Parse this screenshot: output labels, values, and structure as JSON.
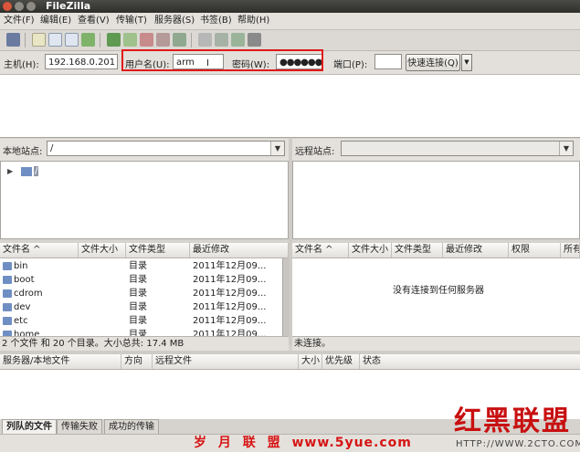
{
  "title": "FileZilla",
  "menu": [
    "文件(F)",
    "编辑(E)",
    "查看(V)",
    "传输(T)",
    "服务器(S)",
    "书签(B)",
    "帮助(H)"
  ],
  "quick": {
    "host_label": "主机(H):",
    "host_value": "192.168.0.201",
    "user_label": "用户名(U):",
    "user_value": "arm",
    "pass_label": "密码(W):",
    "pass_value": "●●●●●●",
    "port_label": "端口(P):",
    "port_value": "",
    "connect_label": "快速连接(Q)"
  },
  "local": {
    "site_label": "本地站点:",
    "path": "/",
    "tree_root": "/",
    "columns": [
      "文件名 ^",
      "文件大小",
      "文件类型",
      "最近修改"
    ],
    "files": [
      {
        "name": "bin",
        "type": "目录",
        "modified": "2011年12月09..."
      },
      {
        "name": "boot",
        "type": "目录",
        "modified": "2011年12月09..."
      },
      {
        "name": "cdrom",
        "type": "目录",
        "modified": "2011年12月09..."
      },
      {
        "name": "dev",
        "type": "目录",
        "modified": "2011年12月09..."
      },
      {
        "name": "etc",
        "type": "目录",
        "modified": "2011年12月09..."
      },
      {
        "name": "home",
        "type": "目录",
        "modified": "2011年12月09..."
      }
    ],
    "status": "2 个文件 和 20 个目录。大小总共: 17.4 MB"
  },
  "remote": {
    "site_label": "远程站点:",
    "path": "",
    "columns": [
      "文件名 ^",
      "文件大小",
      "文件类型",
      "最近修改",
      "权限",
      "所有"
    ],
    "empty_message": "没有连接到任何服务器",
    "status": "未连接。"
  },
  "queue": {
    "columns": [
      "服务器/本地文件",
      "方向",
      "远程文件",
      "大小",
      "优先级",
      "状态"
    ],
    "tabs": [
      "列队的文件",
      "传输失败",
      "成功的传输"
    ]
  },
  "watermark": {
    "left_cn": "岁 月 联 盟",
    "left_url": "www.5yue.com",
    "right_cn": "红黑联盟",
    "right_url": "HTTP://WWW.2CTO.COM"
  },
  "colors": {
    "highlight": "#e01818",
    "watermark": "#d61414"
  }
}
